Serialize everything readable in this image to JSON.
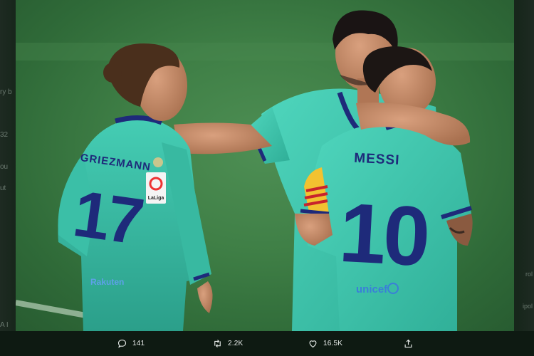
{
  "tweet": {
    "actions": {
      "reply": {
        "icon": "reply-icon",
        "count": "141"
      },
      "retweet": {
        "icon": "retweet-icon",
        "count": "2.2K"
      },
      "like": {
        "icon": "heart-icon",
        "count": "16.5K"
      },
      "share": {
        "icon": "share-icon"
      }
    }
  },
  "photo": {
    "players": [
      {
        "name": "GRIEZMANN",
        "number": "17"
      },
      {
        "name": "MESSI",
        "number": "10"
      }
    ],
    "badge_text": "LaLiga",
    "sponsor_text": "unicef",
    "sleeve_text": "Rakuten"
  },
  "background_fragments": {
    "left": [
      "ry b",
      "32",
      "ou",
      "ut",
      "A I"
    ],
    "right": [
      "rol",
      "ipol"
    ]
  },
  "colors": {
    "kit": "#3fc9b0",
    "kit_dark": "#2aa892",
    "trim": "#1e2a7a",
    "pitch": "#3f7f46"
  }
}
